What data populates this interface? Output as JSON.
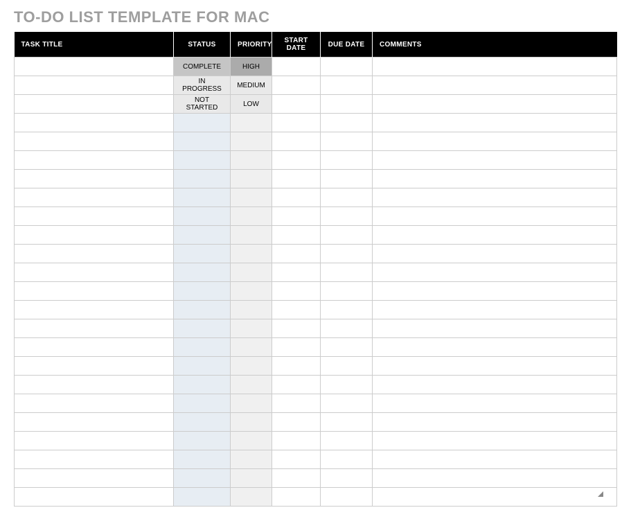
{
  "title": "TO-DO LIST TEMPLATE FOR MAC",
  "columns": {
    "task_title": "TASK TITLE",
    "status": "STATUS",
    "priority": "PRIORITY",
    "start_date": "START DATE",
    "due_date": "DUE DATE",
    "comments": "COMMENTS"
  },
  "status_options": [
    "COMPLETE",
    "IN PROGRESS",
    "NOT STARTED"
  ],
  "priority_options": [
    "HIGH",
    "MEDIUM",
    "LOW"
  ],
  "rows": [
    {
      "task_title": "",
      "status": "COMPLETE",
      "priority": "HIGH",
      "start_date": "",
      "due_date": "",
      "comments": ""
    },
    {
      "task_title": "",
      "status": "IN PROGRESS",
      "priority": "MEDIUM",
      "start_date": "",
      "due_date": "",
      "comments": ""
    },
    {
      "task_title": "",
      "status": "NOT STARTED",
      "priority": "LOW",
      "start_date": "",
      "due_date": "",
      "comments": ""
    },
    {
      "task_title": "",
      "status": "",
      "priority": "",
      "start_date": "",
      "due_date": "",
      "comments": ""
    },
    {
      "task_title": "",
      "status": "",
      "priority": "",
      "start_date": "",
      "due_date": "",
      "comments": ""
    },
    {
      "task_title": "",
      "status": "",
      "priority": "",
      "start_date": "",
      "due_date": "",
      "comments": ""
    },
    {
      "task_title": "",
      "status": "",
      "priority": "",
      "start_date": "",
      "due_date": "",
      "comments": ""
    },
    {
      "task_title": "",
      "status": "",
      "priority": "",
      "start_date": "",
      "due_date": "",
      "comments": ""
    },
    {
      "task_title": "",
      "status": "",
      "priority": "",
      "start_date": "",
      "due_date": "",
      "comments": ""
    },
    {
      "task_title": "",
      "status": "",
      "priority": "",
      "start_date": "",
      "due_date": "",
      "comments": ""
    },
    {
      "task_title": "",
      "status": "",
      "priority": "",
      "start_date": "",
      "due_date": "",
      "comments": ""
    },
    {
      "task_title": "",
      "status": "",
      "priority": "",
      "start_date": "",
      "due_date": "",
      "comments": ""
    },
    {
      "task_title": "",
      "status": "",
      "priority": "",
      "start_date": "",
      "due_date": "",
      "comments": ""
    },
    {
      "task_title": "",
      "status": "",
      "priority": "",
      "start_date": "",
      "due_date": "",
      "comments": ""
    },
    {
      "task_title": "",
      "status": "",
      "priority": "",
      "start_date": "",
      "due_date": "",
      "comments": ""
    },
    {
      "task_title": "",
      "status": "",
      "priority": "",
      "start_date": "",
      "due_date": "",
      "comments": ""
    },
    {
      "task_title": "",
      "status": "",
      "priority": "",
      "start_date": "",
      "due_date": "",
      "comments": ""
    },
    {
      "task_title": "",
      "status": "",
      "priority": "",
      "start_date": "",
      "due_date": "",
      "comments": ""
    },
    {
      "task_title": "",
      "status": "",
      "priority": "",
      "start_date": "",
      "due_date": "",
      "comments": ""
    },
    {
      "task_title": "",
      "status": "",
      "priority": "",
      "start_date": "",
      "due_date": "",
      "comments": ""
    },
    {
      "task_title": "",
      "status": "",
      "priority": "",
      "start_date": "",
      "due_date": "",
      "comments": ""
    },
    {
      "task_title": "",
      "status": "",
      "priority": "",
      "start_date": "",
      "due_date": "",
      "comments": ""
    },
    {
      "task_title": "",
      "status": "",
      "priority": "",
      "start_date": "",
      "due_date": "",
      "comments": ""
    },
    {
      "task_title": "",
      "status": "",
      "priority": "",
      "start_date": "",
      "due_date": "",
      "comments": ""
    }
  ]
}
